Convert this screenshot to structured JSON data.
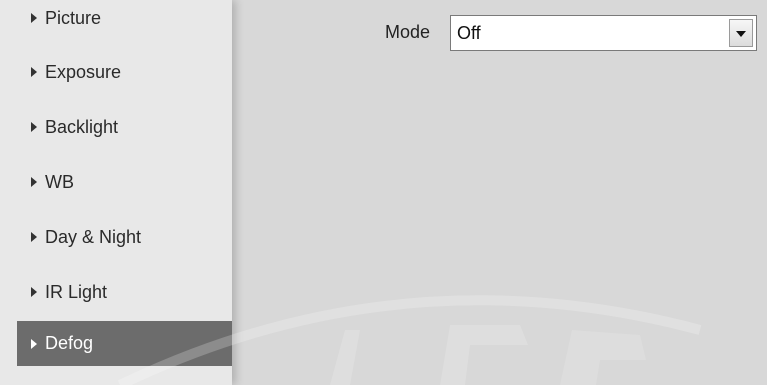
{
  "sidebar": {
    "items": [
      {
        "label": "Picture",
        "active": false
      },
      {
        "label": "Exposure",
        "active": false
      },
      {
        "label": "Backlight",
        "active": false
      },
      {
        "label": "WB",
        "active": false
      },
      {
        "label": "Day & Night",
        "active": false
      },
      {
        "label": "IR Light",
        "active": false
      },
      {
        "label": "Defog",
        "active": true
      }
    ],
    "active_color": "#6c6c6c"
  },
  "form": {
    "mode_label": "Mode",
    "mode_value": "Off"
  },
  "icons": {
    "nav_arrow": "triangle-right-icon",
    "dropdown": "chevron-down-icon"
  }
}
